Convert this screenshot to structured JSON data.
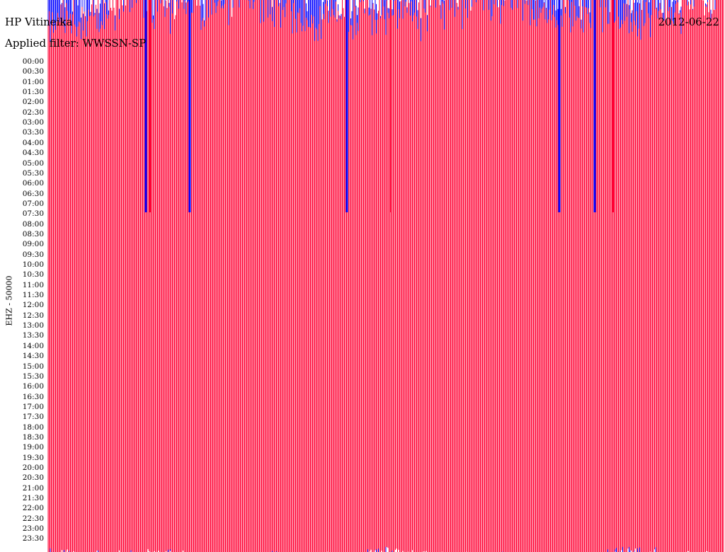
{
  "header": {
    "station": "HP Vitineika",
    "date": "2012-06-22",
    "filter": "Applied filter: WWSSN-SP"
  },
  "channel_label": "EHZ - 50000",
  "colors": {
    "trace_a": "#0000ff",
    "trace_b": "#ff0033",
    "background": "#ffffff"
  },
  "chart_data": {
    "type": "line",
    "title": "HP Vitineika",
    "subtitle": "Applied filter: WWSSN-SP",
    "date": "2012-06-22",
    "ylabel": "EHZ - 50000",
    "row_labels": [
      "00:00",
      "00:30",
      "01:00",
      "01:30",
      "02:00",
      "02:30",
      "03:00",
      "03:30",
      "04:00",
      "04:30",
      "05:00",
      "05:30",
      "06:00",
      "06:30",
      "07:00",
      "07:30",
      "08:00",
      "08:30",
      "09:00",
      "09:30",
      "10:00",
      "10:30",
      "11:00",
      "11:30",
      "12:00",
      "12:30",
      "13:00",
      "13:30",
      "14:00",
      "14:30",
      "15:00",
      "15:30",
      "16:00",
      "16:30",
      "17:00",
      "17:30",
      "18:00",
      "18:30",
      "19:00",
      "19:30",
      "20:00",
      "20:30",
      "21:00",
      "21:30",
      "22:00",
      "22:30",
      "23:00",
      "23:30"
    ],
    "series": [
      {
        "color": "#0000ff"
      },
      {
        "color": "#ff0033"
      }
    ],
    "grid": false
  }
}
